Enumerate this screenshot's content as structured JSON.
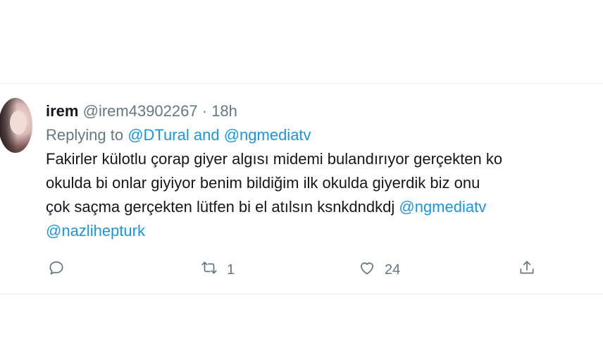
{
  "tweet": {
    "name": "irem",
    "handle": "@irem43902267",
    "separator": "·",
    "time": "18h",
    "replying_prefix": "Replying to",
    "reply_user1": "@DTural",
    "reply_and": "and",
    "reply_user2": "@ngmediatv",
    "lines": [
      "Fakirler külotlu çorap giyer algısı midemi bulandırıyor gerçekten ko",
      "okulda bi onlar giyiyor benim bildiğim ilk okulda giyerdik biz onu",
      "çok saçma gerçekten lütfen bi el atılsın ksnkdndkdj "
    ],
    "mention1": "@ngmediatv",
    "mention2": "@nazlihepturk",
    "retweet_count": "1",
    "like_count": "24"
  },
  "icons": [
    "reply-icon",
    "retweet-icon",
    "like-icon",
    "share-icon"
  ],
  "colors": {
    "link": "#1b95e0",
    "muted": "#657786",
    "text": "#14171a"
  }
}
